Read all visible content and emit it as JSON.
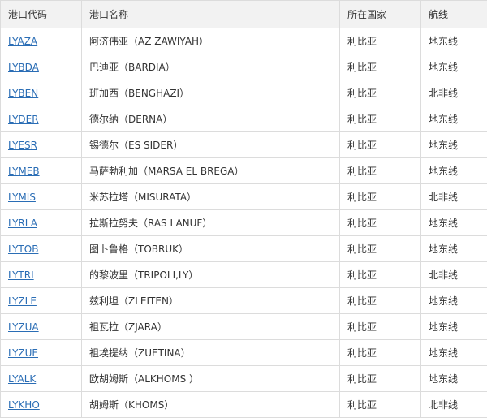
{
  "headers": [
    "港口代码",
    "港口名称",
    "所在国家",
    "航线"
  ],
  "rows": [
    {
      "code": "LYAZA",
      "name": "阿济伟亚（AZ ZAWIYAH）",
      "country": "利比亚",
      "route": "地东线"
    },
    {
      "code": "LYBDA",
      "name": "巴迪亚（BARDIA）",
      "country": "利比亚",
      "route": "地东线"
    },
    {
      "code": "LYBEN",
      "name": "班加西（BENGHAZI）",
      "country": "利比亚",
      "route": "北非线"
    },
    {
      "code": "LYDER",
      "name": "德尔纳（DERNA）",
      "country": "利比亚",
      "route": "地东线"
    },
    {
      "code": "LYESR",
      "name": "锡德尔（ES SIDER）",
      "country": "利比亚",
      "route": "地东线"
    },
    {
      "code": "LYMEB",
      "name": "马萨勃利加（MARSA EL BREGA）",
      "country": "利比亚",
      "route": "地东线"
    },
    {
      "code": "LYMIS",
      "name": "米苏拉塔（MISURATA）",
      "country": "利比亚",
      "route": "北非线"
    },
    {
      "code": "LYRLA",
      "name": "拉斯拉努夫（RAS LANUF）",
      "country": "利比亚",
      "route": "地东线"
    },
    {
      "code": "LYTOB",
      "name": "图卜鲁格（TOBRUK）",
      "country": "利比亚",
      "route": "地东线"
    },
    {
      "code": "LYTRI",
      "name": "的黎波里（TRIPOLI,LY）",
      "country": "利比亚",
      "route": "北非线"
    },
    {
      "code": "LYZLE",
      "name": "兹利坦（ZLEITEN）",
      "country": "利比亚",
      "route": "地东线"
    },
    {
      "code": "LYZUA",
      "name": "祖瓦拉（ZJARA）",
      "country": "利比亚",
      "route": "地东线"
    },
    {
      "code": "LYZUE",
      "name": "祖埃提纳（ZUETINA）",
      "country": "利比亚",
      "route": "地东线"
    },
    {
      "code": "LYALK",
      "name": "欧胡姆斯（ALKHOMS ）",
      "country": "利比亚",
      "route": "地东线"
    },
    {
      "code": "LYKHO",
      "name": "胡姆斯（KHOMS）",
      "country": "利比亚",
      "route": "北非线"
    }
  ]
}
